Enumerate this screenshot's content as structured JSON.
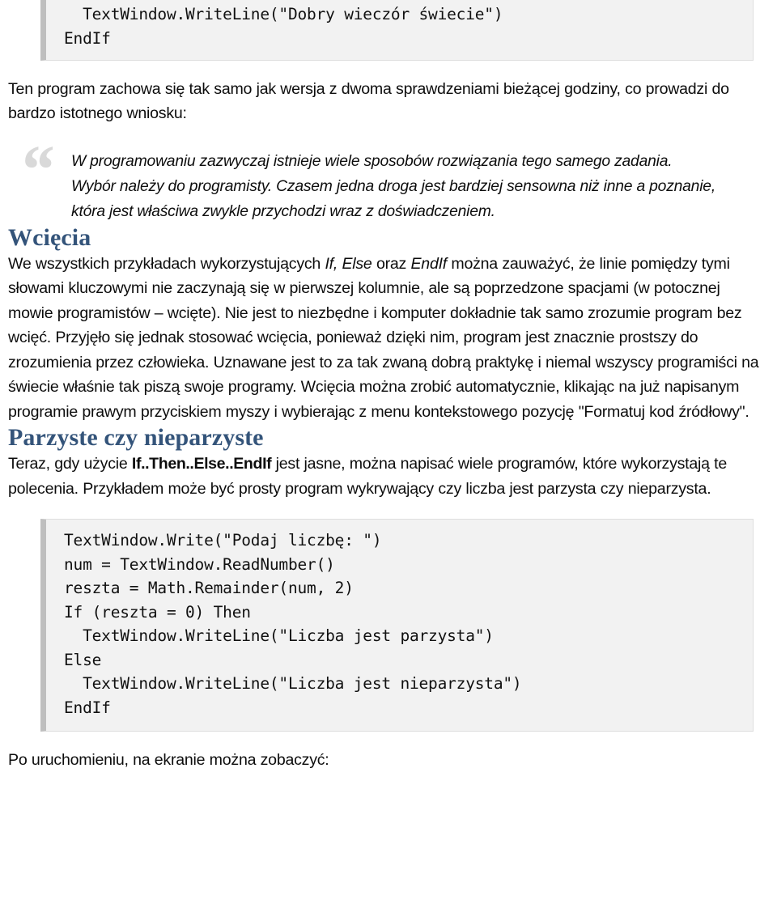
{
  "document": {
    "language": "pl",
    "colors": {
      "heading": "#34547a",
      "body_text": "#0d0d0d",
      "code_background": "#f2f2f2",
      "code_left_bar": "#bfbfbf",
      "code_border": "#dedede",
      "quote_mark": "#d9d9d9"
    }
  },
  "code_top": {
    "lines": "  TextWindow.WriteLine(\"Dobry wieczór świecie\")\nEndIf"
  },
  "intro_paragraph": {
    "text": "Ten program zachowa się tak samo jak wersja z dwoma sprawdzeniami bieżącej godziny, co prowadzi do bardzo istotnego wniosku:"
  },
  "blockquote": {
    "quote_glyph": "“",
    "text": "W programowaniu zazwyczaj istnieje wiele sposobów rozwiązania tego samego zadania. Wybór należy do programisty. Czasem jedna droga jest bardziej sensowna niż inne a poznanie, która jest właściwa zwykle przychodzi wraz z doświadczeniem."
  },
  "section_wciecia": {
    "heading": "Wcięcia",
    "para_part_1": "We wszystkich przykładach wykorzystujących ",
    "em_1": "If, Else",
    "para_part_2": " oraz ",
    "em_2": "EndIf",
    "para_part_3": " można zauważyć, że linie pomiędzy tymi słowami kluczowymi nie zaczynają się w pierwszej kolumnie, ale są poprzedzone spacjami (w potocznej mowie programistów – wcięte). Nie jest to niezbędne i komputer dokładnie tak samo zrozumie program bez wcięć. Przyjęło się jednak stosować wcięcia, ponieważ dzięki nim, program jest znacznie prostszy do zrozumienia przez człowieka. Uznawane jest to za tak zwaną dobrą praktykę i niemal wszyscy programiści na świecie właśnie tak piszą swoje programy. Wcięcia można zrobić automatycznie, klikając na już napisanym programie prawym przyciskiem myszy i wybierając z menu kontekstowego pozycję \"Formatuj kod źródłowy\"."
  },
  "section_parzyste": {
    "heading": "Parzyste czy nieparzyste",
    "para_part_1": "Teraz, gdy użycie ",
    "bold_1": "If..Then..Else..EndIf",
    "para_part_2": " jest jasne, można napisać wiele programów, które wykorzystają te polecenia. Przykładem może być prosty program wykrywający czy liczba jest parzysta czy nieparzysta."
  },
  "code_bottom": {
    "lines": "TextWindow.Write(\"Podaj liczbę: \")\nnum = TextWindow.ReadNumber()\nreszta = Math.Remainder(num, 2)\nIf (reszta = 0) Then\n  TextWindow.WriteLine(\"Liczba jest parzysta\")\nElse\n  TextWindow.WriteLine(\"Liczba jest nieparzysta\")\nEndIf"
  },
  "tail_paragraph": {
    "text": "Po uruchomieniu, na ekranie można zobaczyć:"
  }
}
